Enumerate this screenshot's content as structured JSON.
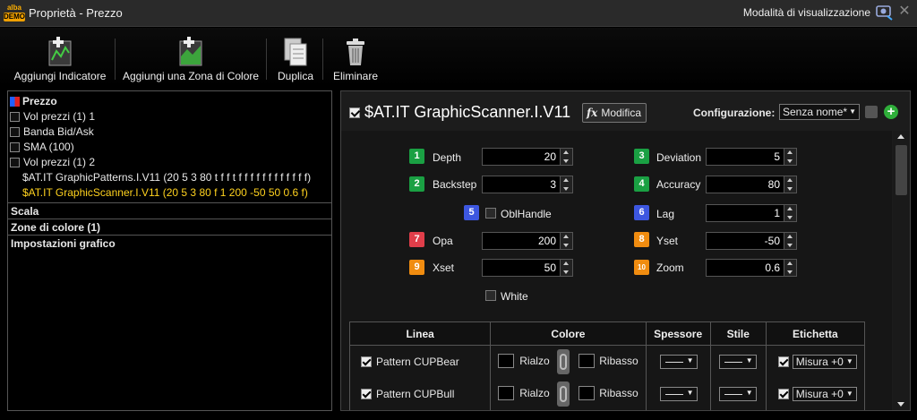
{
  "window": {
    "logo_top": "alba",
    "logo_bottom": "DEMO",
    "title": "Proprietà - Prezzo",
    "view_mode_label": "Modalità di visualizzazione",
    "close_glyph": "✕"
  },
  "toolbar": {
    "add_indicator": "Aggiungi Indicatore",
    "add_color_zone": "Aggiungi una Zona di Colore",
    "duplicate": "Duplica",
    "delete": "Eliminare"
  },
  "tree": {
    "root": "Prezzo",
    "items": [
      "Vol prezzi (1) 1",
      "Banda Bid/Ask",
      "SMA (100)",
      "Vol prezzi (1) 2"
    ],
    "sub_items": [
      "$AT.IT GraphicPatterns.I.V11 (20 5 3 80 t f f t f f f f f f f f f f f f)",
      "$AT.IT GraphicScanner.I.V11 (20 5 3 80 f 1 200 -50 50 0.6 f)"
    ],
    "sections": [
      "Scala",
      "Zone di colore (1)",
      "Impostazioni grafico"
    ]
  },
  "indicator": {
    "title": "$AT.IT GraphicScanner.I.V11",
    "edit_label": "Modifica",
    "fx_glyph": "fx",
    "config_label": "Configurazione:",
    "config_value": "Senza nome*",
    "add_glyph": "+"
  },
  "params": {
    "left": [
      {
        "num": "1",
        "label": "Depth",
        "value": "20"
      },
      {
        "num": "2",
        "label": "Backstep",
        "value": "3"
      },
      {
        "num": "7",
        "label": "Opa",
        "value": "200"
      },
      {
        "num": "9",
        "label": "Xset",
        "value": "50"
      }
    ],
    "right": [
      {
        "num": "3",
        "label": "Deviation",
        "value": "5"
      },
      {
        "num": "4",
        "label": "Accuracy",
        "value": "80"
      },
      {
        "num": "6",
        "label": "Lag",
        "value": "1"
      },
      {
        "num": "8",
        "label": "Yset",
        "value": "-50"
      },
      {
        "num": "10",
        "label": "Zoom",
        "value": "0.6"
      }
    ],
    "obl_num": "5",
    "obl_label": "OblHandle",
    "white_label": "White"
  },
  "table": {
    "headers": [
      "Linea",
      "Colore",
      "Spessore",
      "Stile",
      "Etichetta"
    ],
    "rows": [
      {
        "name": "Pattern CUPBear",
        "up": "Rialzo",
        "down": "Ribasso",
        "label": "Misura +0"
      },
      {
        "name": "Pattern CUPBull",
        "up": "Rialzo",
        "down": "Ribasso",
        "label": "Misura +0"
      }
    ]
  },
  "colors": {
    "badge_green": "#1aa043",
    "badge_blue": "#3d57e0",
    "badge_red": "#e03e4a",
    "badge_orange": "#f08c10",
    "highlight_yellow": "#ffd21e"
  }
}
